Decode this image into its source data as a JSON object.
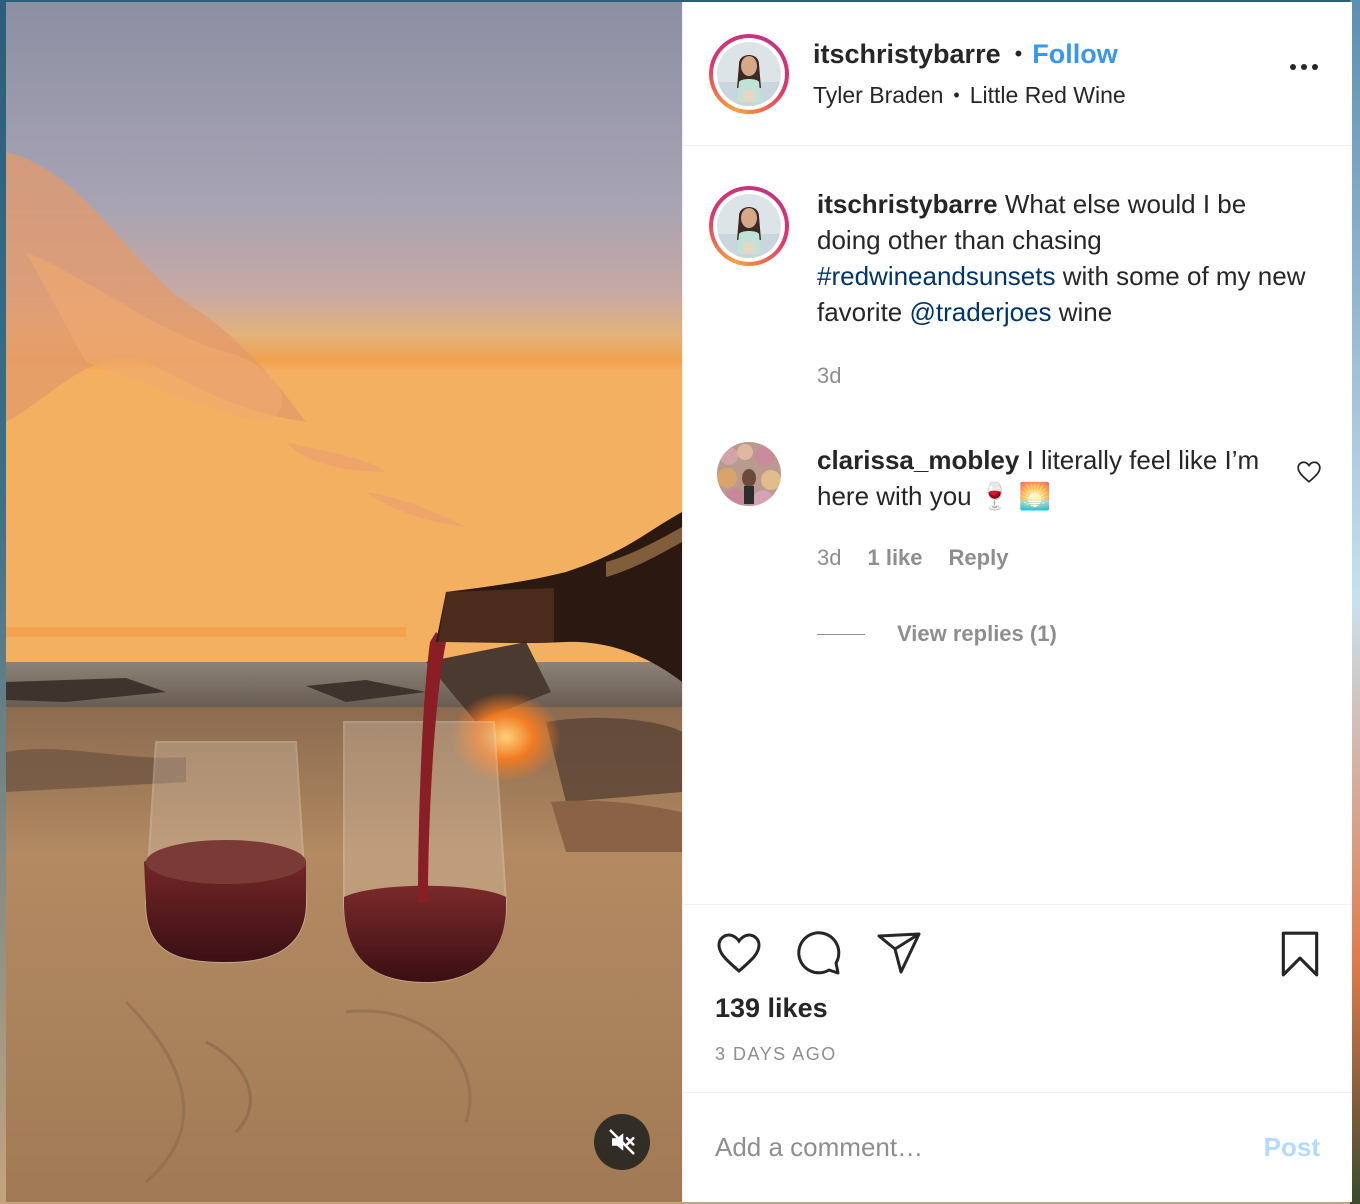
{
  "post": {
    "author": {
      "username": "itschristybarre",
      "follow_label": "Follow",
      "audio_artist": "Tyler Braden",
      "audio_track": "Little Red Wine"
    },
    "caption": {
      "username": "itschristybarre",
      "text_1": " What else would I be doing other than chasing ",
      "hashtag": "#redwineandsunsets",
      "text_2": " with some of my new favorite ",
      "mention": "@traderjoes",
      "text_3": " wine",
      "time": "3d"
    },
    "comments": [
      {
        "username": "clarissa_mobley",
        "text": " I literally feel like I’m here with you 🍷 🌅",
        "time": "3d",
        "likes": "1 like",
        "reply_label": "Reply",
        "view_replies": "View replies (1)"
      }
    ],
    "likes": "139 likes",
    "timestamp": "3 DAYS AGO",
    "add_comment_placeholder": "Add a comment…",
    "post_label": "Post"
  },
  "icons": {
    "header_more": "more-options-icon",
    "like": "heart-icon",
    "comment": "comment-icon",
    "share": "send-icon",
    "save": "bookmark-icon",
    "mute": "muted-speaker-icon"
  },
  "colors": {
    "link": "#003569",
    "follow": "#3897f0",
    "muted_text": "#8e8e8e",
    "post_disabled": "#b3dbff"
  }
}
